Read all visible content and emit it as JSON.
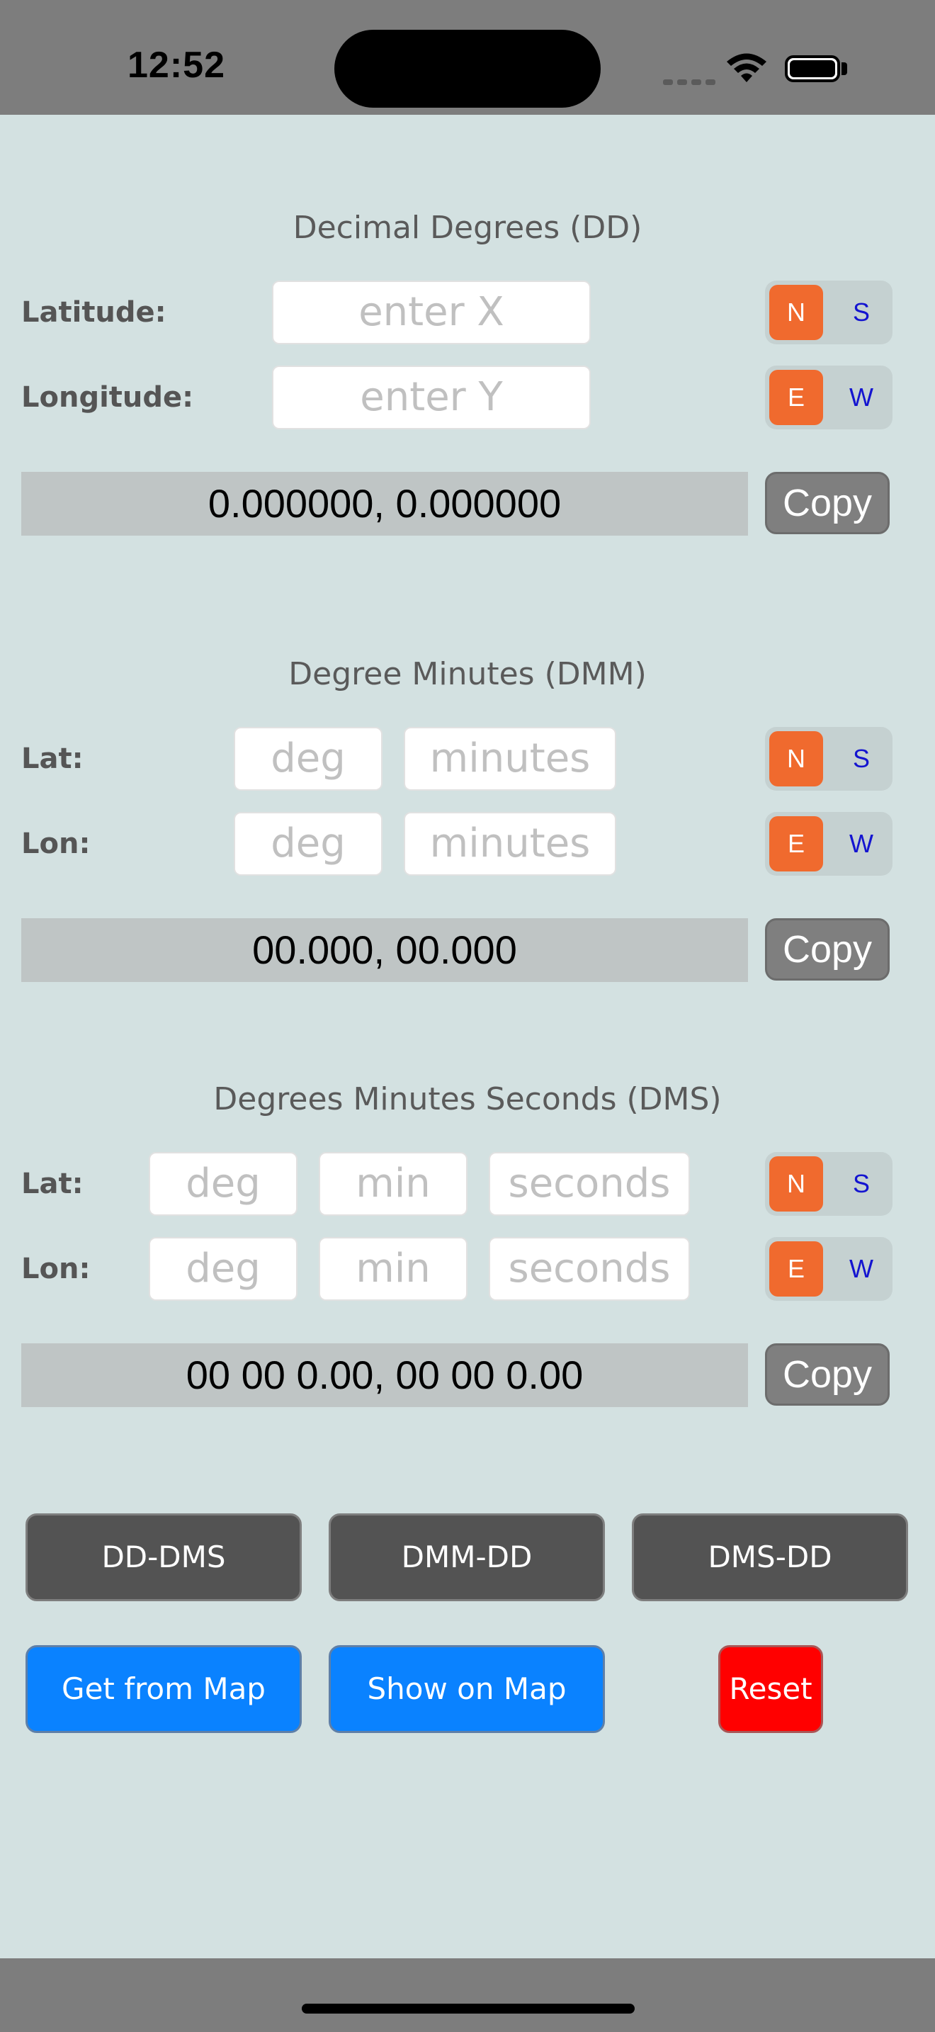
{
  "status_bar": {
    "time": "12:52"
  },
  "dd": {
    "title": "Decimal Degrees (DD)",
    "lat_label": "Latitude:",
    "lon_label": "Longitude:",
    "lat_placeholder": "enter X",
    "lon_placeholder": "enter Y",
    "lat_toggle": {
      "selected": "N",
      "other": "S"
    },
    "lon_toggle": {
      "selected": "E",
      "other": "W"
    },
    "result": "0.000000, 0.000000",
    "copy_label": "Copy"
  },
  "dmm": {
    "title": "Degree Minutes (DMM)",
    "lat_label": "Lat:",
    "lon_label": "Lon:",
    "deg_placeholder": "deg",
    "minutes_placeholder": "minutes",
    "lat_toggle": {
      "selected": "N",
      "other": "S"
    },
    "lon_toggle": {
      "selected": "E",
      "other": "W"
    },
    "result": "00.000, 00.000",
    "copy_label": "Copy"
  },
  "dms": {
    "title": "Degrees Minutes Seconds (DMS)",
    "lat_label": "Lat:",
    "lon_label": "Lon:",
    "deg_placeholder": "deg",
    "min_placeholder": "min",
    "seconds_placeholder": "seconds",
    "lat_toggle": {
      "selected": "N",
      "other": "S"
    },
    "lon_toggle": {
      "selected": "E",
      "other": "W"
    },
    "result": "00 00 0.00, 00 00 0.00",
    "copy_label": "Copy"
  },
  "actions": {
    "dd_dms": "DD-DMS",
    "dmm_dd": "DMM-DD",
    "dms_dd": "DMS-DD",
    "get_from_map": "Get from Map",
    "show_on_map": "Show on Map",
    "reset": "Reset"
  },
  "colors": {
    "background": "#d3e1e1",
    "toggle_selected": "#f06a2e",
    "toggle_unselected_text": "#1414d0",
    "blue_button": "#0a82ff",
    "reset_button": "#ff0000"
  }
}
